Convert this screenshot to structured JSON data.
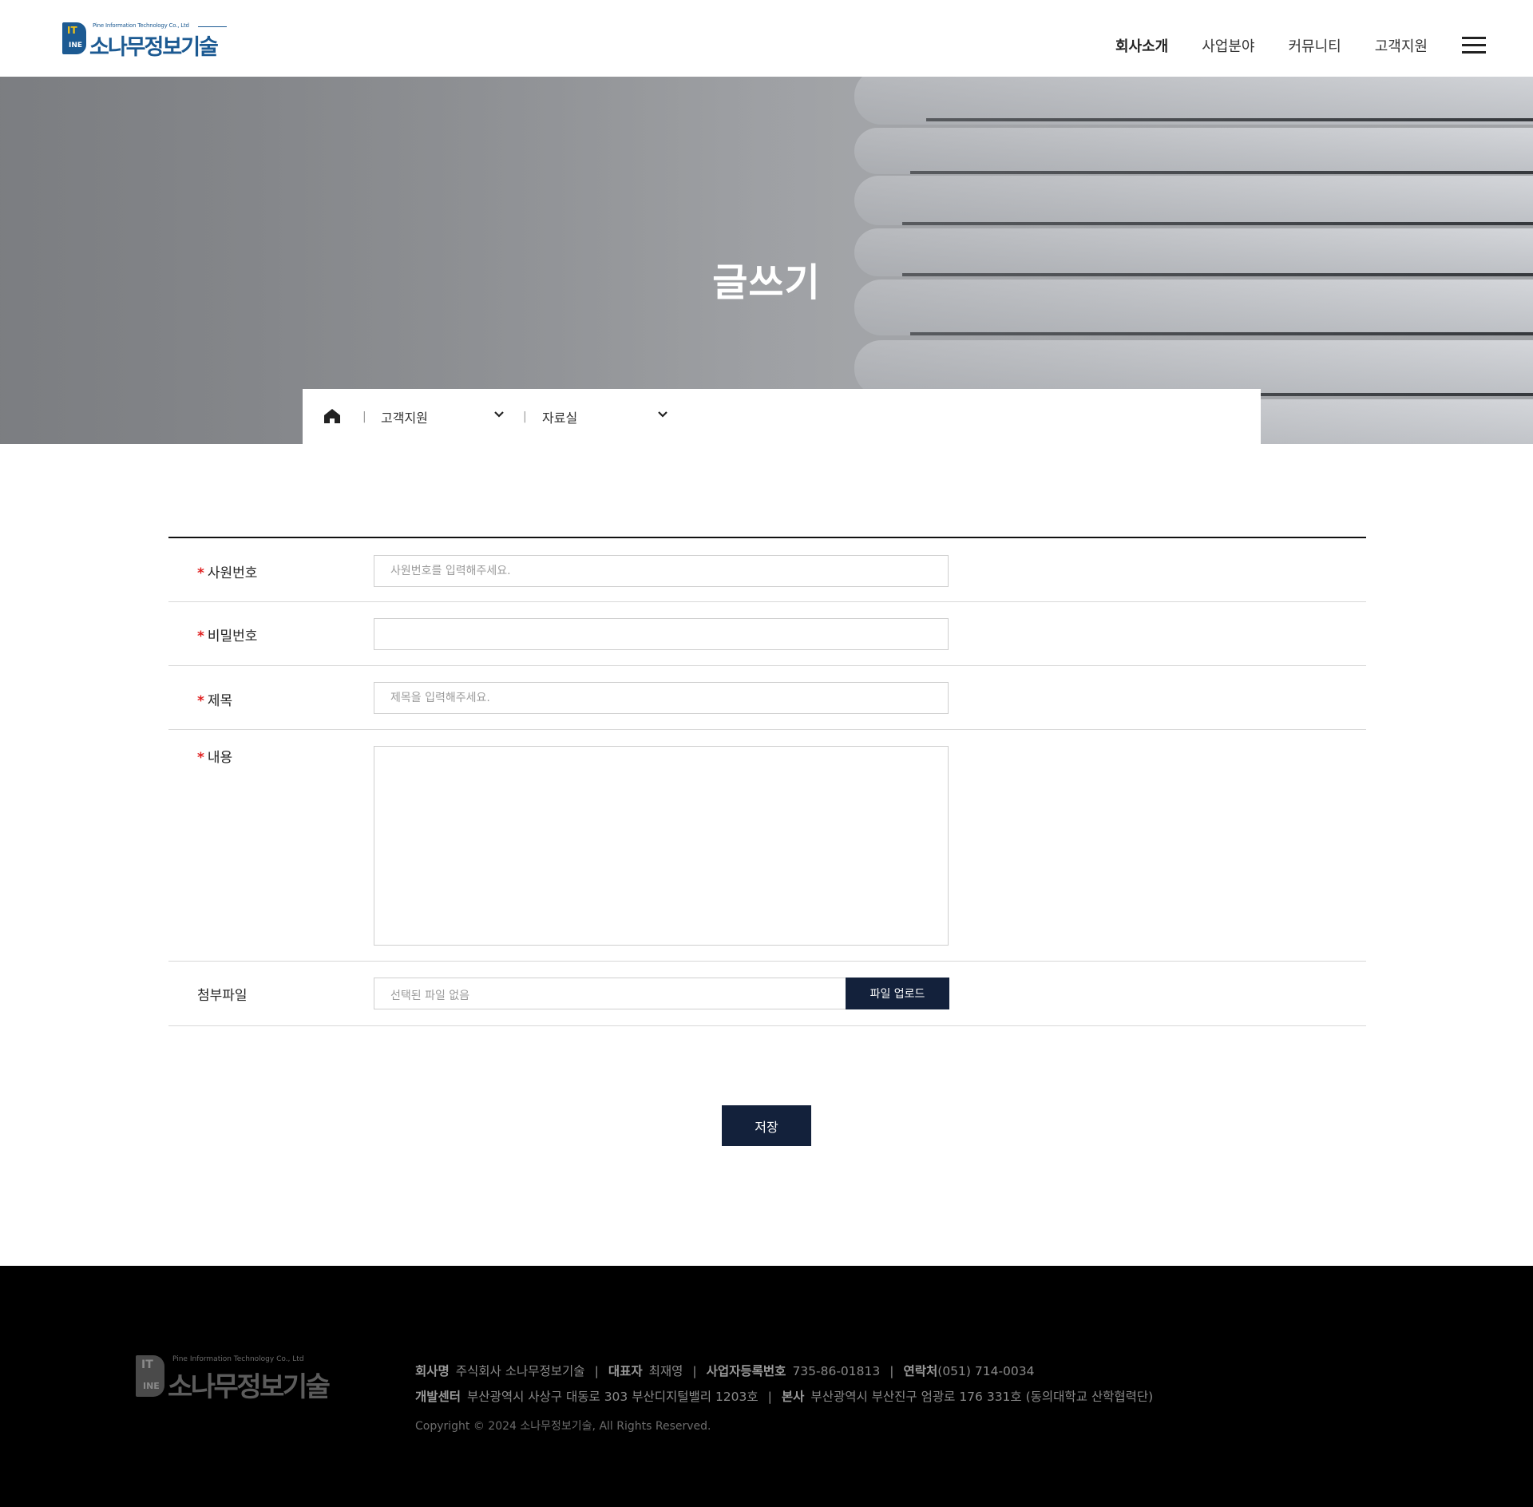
{
  "header": {
    "logo": {
      "tagline": "Pine Information Technology Co., Ltd",
      "mark_top": "IT",
      "mark_bottom": "INE",
      "name": "소나무정보기술"
    },
    "nav": [
      "회사소개",
      "사업분야",
      "커뮤니티",
      "고객지원"
    ],
    "active_nav": "회사소개"
  },
  "hero": {
    "title": "글쓰기"
  },
  "breadcrumb": {
    "level1": "고객지원",
    "level2": "자료실"
  },
  "form": {
    "employee_no": {
      "label": "사원번호",
      "required": "*",
      "placeholder": "사원번호를 입력해주세요.",
      "value": ""
    },
    "password": {
      "label": "비밀번호",
      "required": "*",
      "value": ""
    },
    "title": {
      "label": "제목",
      "required": "*",
      "placeholder": "제목을 입력해주세요.",
      "value": ""
    },
    "content": {
      "label": "내용",
      "required": "*",
      "value": ""
    },
    "attachment": {
      "label": "첨부파일",
      "status": "선택된 파일 없음",
      "button": "파일 업로드"
    },
    "save_button": "저장"
  },
  "footer": {
    "logo": {
      "tagline": "Pine Information Technology Co., Ltd",
      "mark_top": "IT",
      "mark_bottom": "INE",
      "name": "소나무정보기술"
    },
    "company_label": "회사명",
    "company": "주식회사 소나무정보기술",
    "ceo_label": "대표자",
    "ceo": "최재영",
    "biz_label": "사업자등록번호",
    "biz_no": "735-86-01813",
    "contact_label": "연락처",
    "contact": "(051) 714-0034",
    "dev_label": "개발센터",
    "dev_address": "부산광역시 사상구 대동로 303 부산디지털밸리 1203호",
    "hq_label": "본사",
    "hq_address": "부산광역시 부산진구 엄광로 176 331호 (동의대학교 산학협력단)",
    "copyright": "Copyright © 2024 소나무정보기술, All Rights Reserved."
  },
  "colors": {
    "brand": "#1c5a92",
    "button": "#13213b",
    "required": "#e02020",
    "footer_bg": "#000000"
  }
}
